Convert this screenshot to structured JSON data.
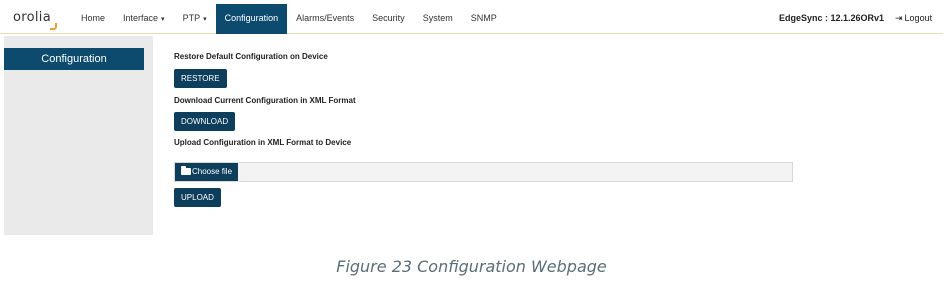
{
  "logo": {
    "text": "orolia"
  },
  "nav": {
    "items": [
      {
        "label": "Home"
      },
      {
        "label": "Interface",
        "dropdown": true
      },
      {
        "label": "PTP",
        "dropdown": true
      },
      {
        "label": "Configuration",
        "active": true
      },
      {
        "label": "Alarms/Events"
      },
      {
        "label": "Security"
      },
      {
        "label": "System"
      },
      {
        "label": "SNMP"
      }
    ],
    "caret": "▾"
  },
  "header": {
    "version": "EdgeSync : 12.1.26ORv1",
    "logout_label": "Logout"
  },
  "sidebar": {
    "items": [
      {
        "label": "Configuration"
      }
    ]
  },
  "main": {
    "restore_title": "Restore Default Configuration on Device",
    "restore_button": "RESTORE",
    "download_title": "Download Current Configuration in XML Format",
    "download_button": "DOWNLOAD",
    "upload_title": "Upload Configuration in XML Format to Device",
    "choose_file_label": "Choose file",
    "upload_button": "UPLOAD"
  },
  "caption": "Figure 23 Configuration Webpage",
  "colors": {
    "accent": "#0d4b6e",
    "button": "#0d3f5c",
    "sidebar_bg": "#eaeaea",
    "caption": "#5a6e7a"
  }
}
